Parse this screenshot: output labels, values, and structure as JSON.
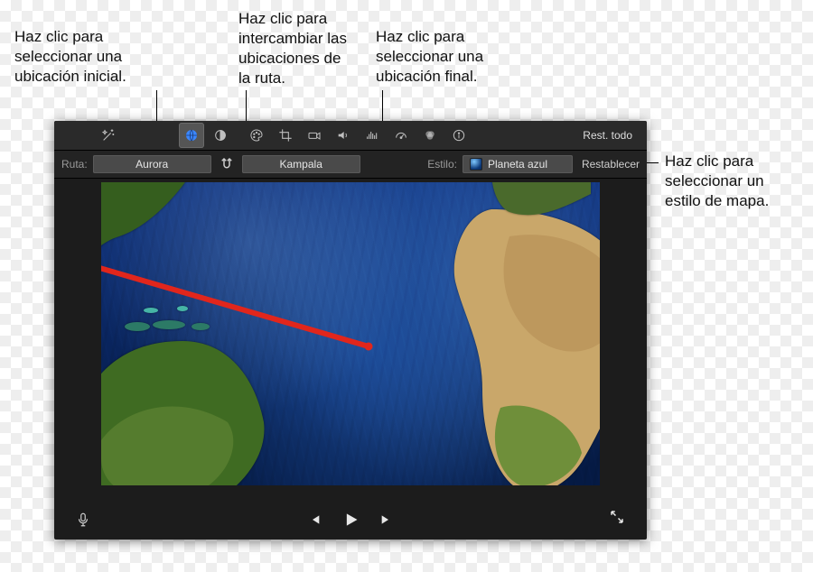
{
  "callouts": {
    "start": "Haz clic para\nseleccionar una\nubicación inicial.",
    "swap": "Haz clic para\nintercambiar las\nubicaciones de\nla ruta.",
    "end": "Haz clic para\nseleccionar una\nubicación final.",
    "style": "Haz clic para\nseleccionar un\nestilo de mapa."
  },
  "toolbar": {
    "reset_all": "Rest. todo"
  },
  "subbar": {
    "ruta_label": "Ruta:",
    "start_location": "Aurora",
    "end_location": "Kampala",
    "estilo_label": "Estilo:",
    "style_name": "Planeta azul",
    "reset": "Restablecer"
  },
  "icons": {
    "magic": "magic-wand-icon",
    "globe": "globe-icon",
    "contrast": "contrast-icon",
    "palette": "palette-icon",
    "crop": "crop-icon",
    "camera": "camera-icon",
    "volume": "volume-icon",
    "eq": "equalizer-icon",
    "speed": "gauge-icon",
    "color": "color-overlap-icon",
    "info": "info-icon",
    "swap": "swap-icon"
  }
}
